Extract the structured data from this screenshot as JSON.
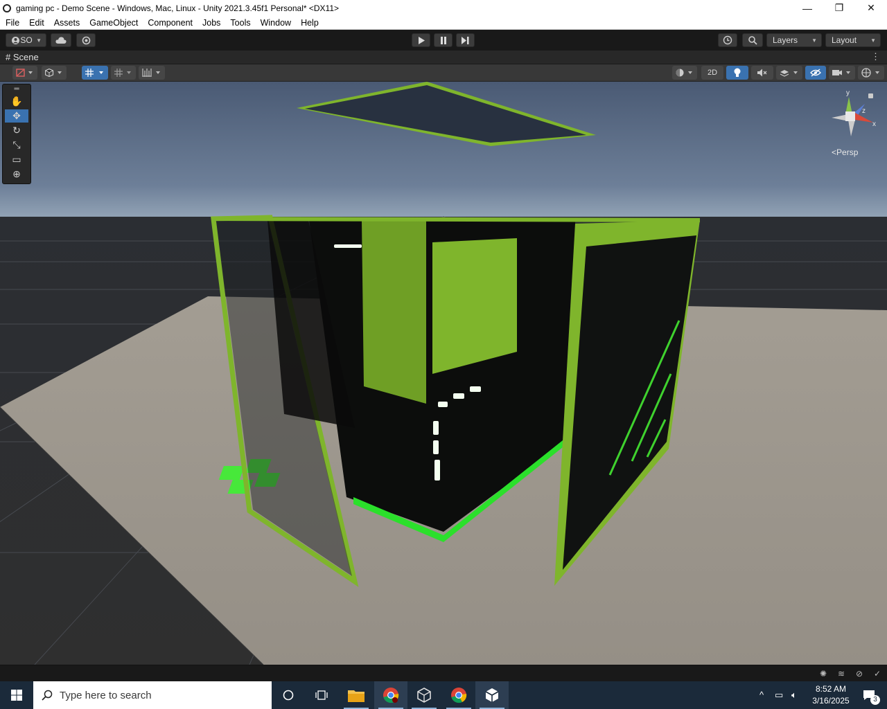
{
  "window": {
    "title": "gaming pc - Demo Scene - Windows, Mac, Linux - Unity 2021.3.45f1 Personal* <DX11>",
    "controls": {
      "minimize": "—",
      "restore": "❐",
      "close": "✕"
    }
  },
  "menu": {
    "items": [
      "File",
      "Edit",
      "Assets",
      "GameObject",
      "Component",
      "Jobs",
      "Tools",
      "Window",
      "Help"
    ]
  },
  "toolbar": {
    "account_label": "SO",
    "layers_label": "Layers",
    "layout_label": "Layout"
  },
  "scene_tab": {
    "label": "Scene"
  },
  "scene_tools": {
    "mode_2d_label": "2D"
  },
  "gizmo": {
    "axis_y": "y",
    "axis_z": "z",
    "axis_x": "x",
    "projection_label": "Persp"
  },
  "taskbar": {
    "search_placeholder": "Type here to search",
    "time": "8:52 AM",
    "date": "3/16/2025",
    "notification_count": "3"
  },
  "colors": {
    "accent_blue": "#3a72b0",
    "case_green": "#7fb52c",
    "led_green": "#19ff3a"
  }
}
